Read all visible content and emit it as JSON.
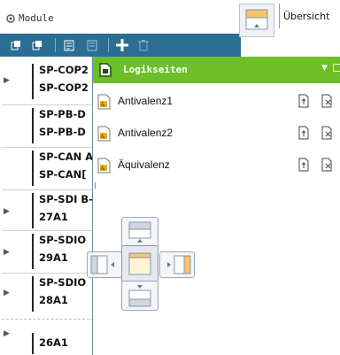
{
  "module_panel": {
    "title": "Module",
    "toolbar": {
      "buttons": [
        "expand-all-icon",
        "collapse-all-icon",
        "properties-icon",
        "list-icon",
        "add-icon",
        "delete-icon"
      ]
    },
    "tree": [
      {
        "line1": "SP-COP2",
        "line2": "SP-COP2",
        "expandable": true
      },
      {
        "line1": "SP-PB-D",
        "line2": "SP-PB-D",
        "expandable": false
      },
      {
        "line1": "SP-CAN A",
        "line2": "SP-CAN[",
        "expandable": false
      },
      {
        "line1": "SP-SDI B-",
        "line2": "27A1",
        "expandable": true
      },
      {
        "line1": "SP-SDIO",
        "line2": "29A1",
        "expandable": true
      },
      {
        "line1": "SP-SDIO",
        "line2": "28A1",
        "expandable": true
      },
      {
        "line1": "",
        "line2": "26A1",
        "expandable": true
      }
    ]
  },
  "overview": {
    "label": "Übersicht"
  },
  "logik_panel": {
    "title": "Logikseiten",
    "accent": "#6dbf2a",
    "pages": [
      {
        "label": "Antivalenz1"
      },
      {
        "label": "Antivalenz2"
      },
      {
        "label": "Äquivalenz"
      }
    ]
  },
  "colors": {
    "toolbar": "#2b6e94",
    "panel_header": "#6dbf2a"
  }
}
